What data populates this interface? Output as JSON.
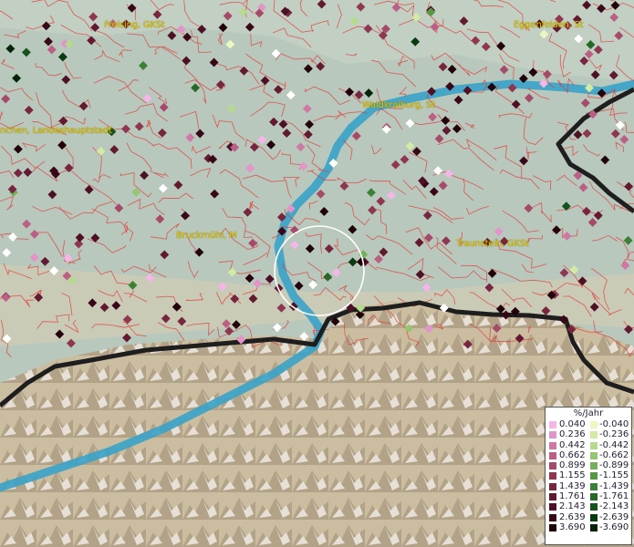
{
  "places": [
    {
      "name": "Freising, GKSt"
    },
    {
      "name": "Eggenfelden, St"
    },
    {
      "name": "Waldkraiburg, St"
    },
    {
      "name": "nchen, Landeshauptstadt"
    },
    {
      "name": "Bruckmühl, M"
    },
    {
      "name": "Traunstein, GKSt"
    }
  ],
  "legend": {
    "title": "%/Jahr",
    "positive": [
      {
        "label": "0.040",
        "color": "#f3b6e6"
      },
      {
        "label": "0.236",
        "color": "#e295c8"
      },
      {
        "label": "0.442",
        "color": "#cf78a6"
      },
      {
        "label": "0.662",
        "color": "#bb6084"
      },
      {
        "label": "0.899",
        "color": "#a64a69"
      },
      {
        "label": "1.155",
        "color": "#8f3651"
      },
      {
        "label": "1.439",
        "color": "#782640"
      },
      {
        "label": "1.761",
        "color": "#621a31"
      },
      {
        "label": "2.143",
        "color": "#4d1024"
      },
      {
        "label": "2.639",
        "color": "#380818"
      },
      {
        "label": "3.690",
        "color": "#22030c"
      }
    ],
    "negative": [
      {
        "label": "-0.040",
        "color": "#edf7c2"
      },
      {
        "label": "-0.236",
        "color": "#d2eba4"
      },
      {
        "label": "-0.442",
        "color": "#b4da8c"
      },
      {
        "label": "-0.662",
        "color": "#93c772"
      },
      {
        "label": "-0.899",
        "color": "#72b05a"
      },
      {
        "label": "-1.155",
        "color": "#559944"
      },
      {
        "label": "-1.439",
        "color": "#3b8034"
      },
      {
        "label": "-1.761",
        "color": "#266826"
      },
      {
        "label": "-2.143",
        "color": "#16521b"
      },
      {
        "label": "-2.639",
        "color": "#0a3b10"
      },
      {
        "label": "-3.690",
        "color": "#022407"
      }
    ]
  }
}
